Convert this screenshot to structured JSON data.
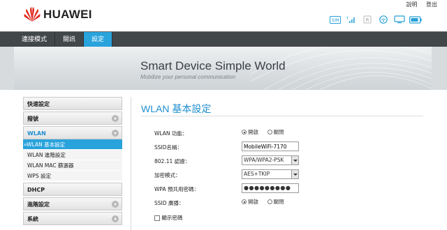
{
  "brand": {
    "name": "HUAWEI",
    "logo_icon": "huawei-logo-icon"
  },
  "toplinks": {
    "help": "說明",
    "logout": "登出"
  },
  "status_icons": [
    "sim-icon",
    "signal-icon",
    "roaming-icon",
    "wifi-icon",
    "computer-icon",
    "battery-icon"
  ],
  "nav": {
    "items": [
      "連接模式",
      "閱訊",
      "設定"
    ],
    "active_index": 2,
    "active_color": "#29a3dc"
  },
  "banner": {
    "title": "Smart Device   Simple World",
    "subtitle": "Mobilize your personal communication"
  },
  "sidebar": {
    "quick_setup": "快速設定",
    "dialup": "撥號",
    "wlan": "WLAN",
    "wlan_sub": [
      "»WLAN 基本設定",
      "WLAN 進階設定",
      "WLAN MAC 篩選器",
      "WPS 設定"
    ],
    "dhcp": "DHCP",
    "advanced": "進階設定",
    "system": "系統"
  },
  "content": {
    "title": "WLAN 基本設定",
    "fields": {
      "wlan_function": {
        "label": "WLAN 功能：",
        "on": "開啟",
        "off": "關閉",
        "selected": "on"
      },
      "ssid_name": {
        "label": "SSID名稱：",
        "value": "MobileWiFi-7170"
      },
      "standard": {
        "label": "802.11 認證：",
        "value": "WPA/WPA2-PSK"
      },
      "encryption": {
        "label": "加密模式：",
        "value": "AES+TKIP"
      },
      "wpa_key": {
        "label": "WPA 預共用密碼：",
        "value": "●●●●●●●●●"
      },
      "ssid_broadcast": {
        "label": "SSID 廣播：",
        "on": "開啟",
        "off": "關閉",
        "selected": "on"
      },
      "show_password": {
        "label": "顯示密碼"
      }
    }
  }
}
